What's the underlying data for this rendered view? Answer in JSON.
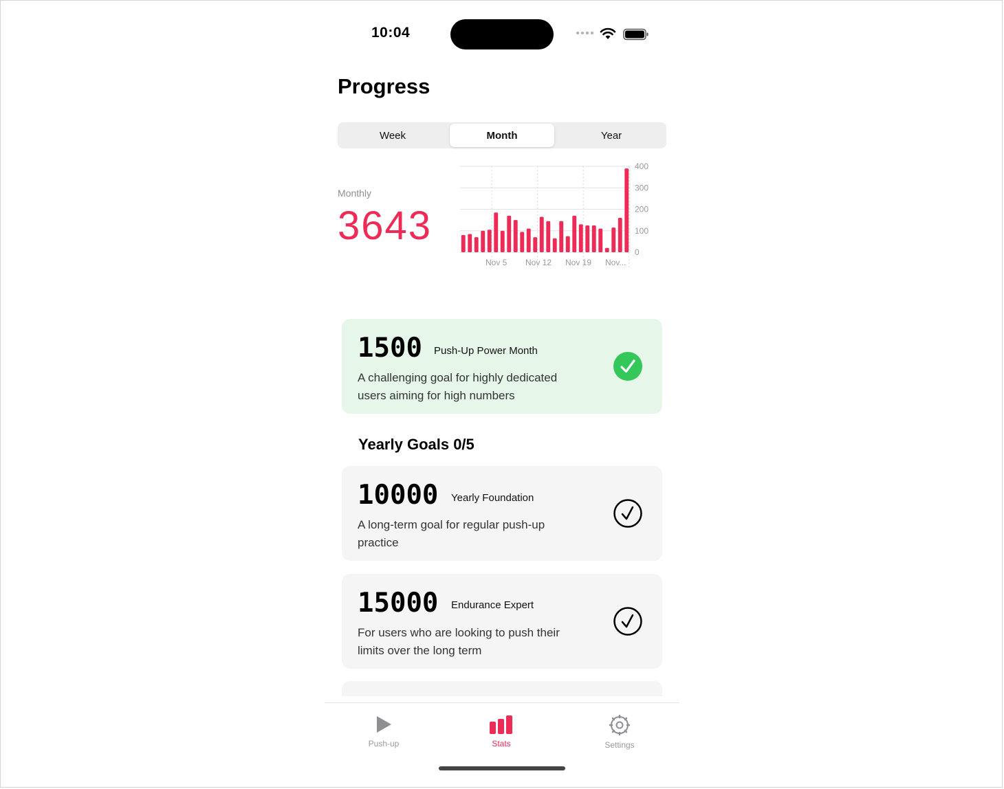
{
  "status_bar": {
    "time": "10:04"
  },
  "page": {
    "title": "Progress"
  },
  "segments": {
    "items": [
      "Week",
      "Month",
      "Year"
    ],
    "selected": "Month"
  },
  "summary": {
    "label": "Monthly",
    "value": "3643"
  },
  "chart_data": {
    "type": "bar",
    "color": "#ee2b56",
    "ylim": [
      0,
      400
    ],
    "y_ticks": [
      "400",
      "300",
      "200",
      "100",
      "0"
    ],
    "x_tick_labels": [
      "Nov 5",
      "Nov 12",
      "Nov 19",
      "Nov..."
    ],
    "values": [
      80,
      85,
      70,
      100,
      105,
      185,
      100,
      170,
      150,
      95,
      110,
      70,
      165,
      145,
      65,
      145,
      75,
      170,
      130,
      125,
      125,
      110,
      20,
      115,
      160,
      390
    ]
  },
  "monthly_goal": {
    "number": "1500",
    "name": "Push-Up Power Month",
    "description": "A challenging goal for highly dedicated users aiming for high numbers",
    "completed_color": "#34c759"
  },
  "yearly": {
    "heading": "Yearly Goals 0/5",
    "goals": [
      {
        "number": "10000",
        "name": "Yearly Foundation",
        "description": "A long-term goal for regular push-up practice"
      },
      {
        "number": "15000",
        "name": "Endurance Expert",
        "description": "For users who are looking to push their limits over the long term"
      }
    ]
  },
  "tabs": [
    {
      "label": "Push-up",
      "icon": "play-icon"
    },
    {
      "label": "Stats",
      "icon": "bar-chart-icon",
      "active": true
    },
    {
      "label": "Settings",
      "icon": "gear-icon"
    }
  ]
}
